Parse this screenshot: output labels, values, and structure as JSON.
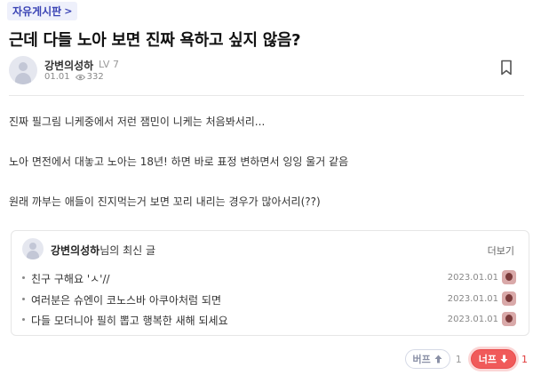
{
  "board": {
    "name": "자유게시판",
    "chevron": ">"
  },
  "post": {
    "title": "근데 다들 노아 보면 진짜 욕하고 싶지 않음?",
    "author": "강변의성하",
    "level": "LV 7",
    "date": "01.01",
    "views": "332",
    "body_lines": [
      "진짜 필그림 니케중에서 저런 잼민이 니케는 처음봐서리...",
      "노아 면전에서 대놓고 노아는 18년! 하면 바로 표정 변하면서 잉잉 울거 같음",
      "원래 까부는 애들이 진지먹는거 보면 꼬리 내리는 경우가 많아서리(??)"
    ]
  },
  "recent": {
    "author": "강변의성하",
    "suffix": "님의 최신 글",
    "more": "더보기",
    "items": [
      {
        "title": "친구 구해요 'ㅅ'//",
        "date": "2023.01.01"
      },
      {
        "title": "여러분은 슈엔이 코노스바 아쿠아처럼 되면",
        "date": "2023.01.01"
      },
      {
        "title": "다들 모더니아 필히 뽑고 행복한 새해 되세요",
        "date": "2023.01.01"
      }
    ]
  },
  "votes": {
    "up_label": "버프",
    "up_count": "1",
    "down_label": "너프",
    "down_count": "1"
  },
  "icons": {
    "chevron": "chevron-right-icon",
    "eye": "eye-icon",
    "bookmark": "bookmark-icon",
    "up_arrow": "arrow-up-icon",
    "down_arrow": "arrow-down-icon"
  },
  "colors": {
    "accent": "#3b44b5",
    "nerf": "#f05a5a"
  }
}
